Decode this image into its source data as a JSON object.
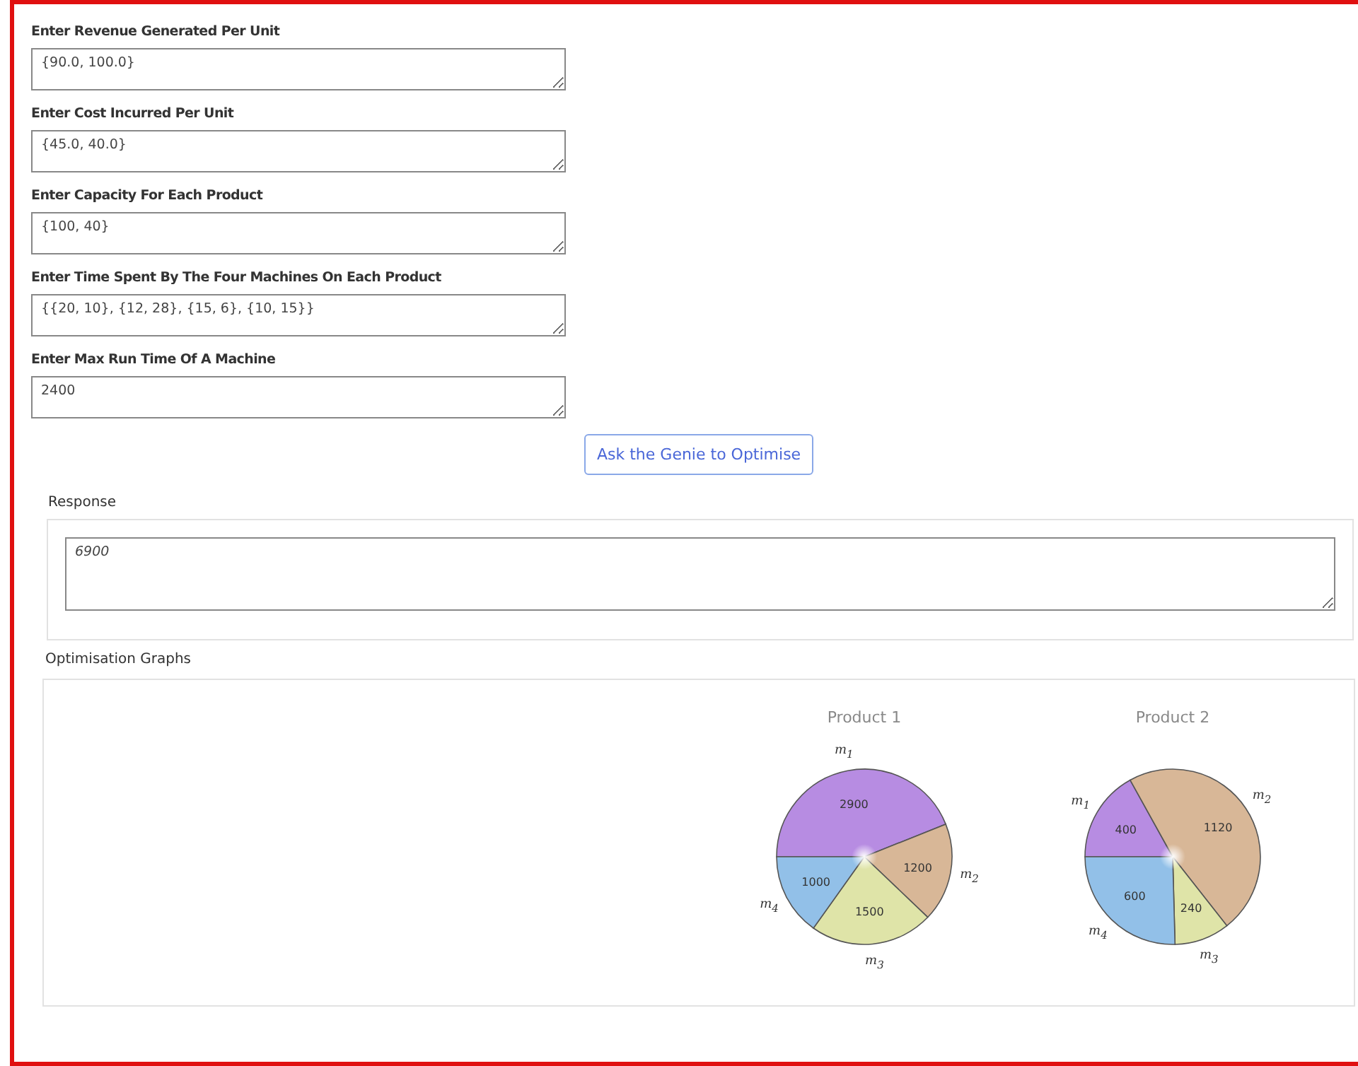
{
  "form": {
    "fields": [
      {
        "label": "Enter Revenue Generated Per Unit",
        "value": "{90.0, 100.0}"
      },
      {
        "label": "Enter Cost Incurred Per Unit",
        "value": "{45.0, 40.0}"
      },
      {
        "label": "Enter Capacity For Each Product",
        "value": "{100, 40}"
      },
      {
        "label": "Enter Time Spent By The Four Machines On Each Product",
        "value": "{{20, 10}, {12, 28}, {15, 6}, {10, 15}}"
      },
      {
        "label": "Enter Max Run Time Of A Machine",
        "value": "2400"
      }
    ],
    "submit_button": "Ask the Genie to Optimise"
  },
  "response": {
    "label": "Response",
    "value": "6900"
  },
  "graphs": {
    "label": "Optimisation Graphs",
    "charts": [
      {
        "chart_data": {
          "type": "pie",
          "title": "Product 1",
          "categories": [
            "m$_{1}$",
            "m$_{2}$",
            "m$_{3}$",
            "m$_{4}$"
          ],
          "values": [
            2900,
            1200,
            1500,
            1000
          ],
          "data_labels": true
        }
      },
      {
        "chart_data": {
          "type": "pie",
          "title": "Product 2",
          "categories": [
            "m$_{1}$",
            "m$_{2}$",
            "m$_{3}$",
            "m$_{4}$"
          ],
          "values": [
            400,
            1120,
            240,
            600
          ],
          "data_labels": true
        }
      }
    ]
  }
}
